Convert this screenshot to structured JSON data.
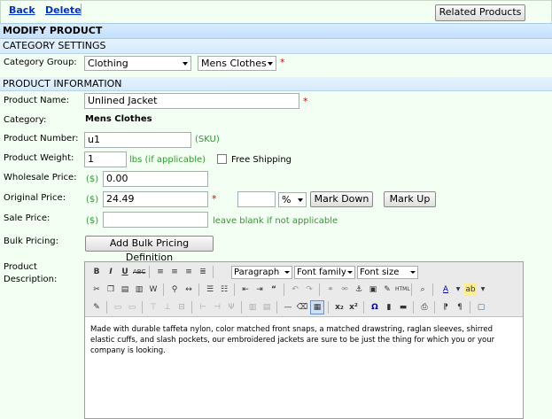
{
  "toolbar": {
    "back": "Back",
    "delete": "Delete",
    "related_products": "Related Products"
  },
  "header": {
    "title": "MODIFY PRODUCT"
  },
  "category_settings": {
    "title": "CATEGORY SETTINGS",
    "group_label": "Category Group:",
    "group_value": "Clothing",
    "sub_value": "Mens Clothes",
    "required": "*"
  },
  "product_info": {
    "title": "PRODUCT INFORMATION",
    "name_label": "Product Name:",
    "name_value": "Unlined Jacket",
    "category_label": "Category:",
    "category_value": "Mens Clothes",
    "number_label": "Product Number:",
    "number_value": "u1",
    "number_hint": "(SKU)",
    "weight_label": "Product Weight:",
    "weight_value": "1",
    "weight_hint": "lbs (if applicable)",
    "free_shipping": "Free Shipping",
    "wholesale_label": "Wholesale Price:",
    "currency": "($)",
    "wholesale_value": "0.00",
    "original_label": "Original Price:",
    "original_value": "24.49",
    "markdown_unit": "%",
    "mark_down": "Mark Down",
    "mark_up": "Mark Up",
    "sale_label": "Sale Price:",
    "sale_hint": "leave blank if not applicable",
    "bulk_label": "Bulk Pricing:",
    "bulk_button": "Add Bulk Pricing Definition",
    "description_label_1": "Product",
    "description_label_2": "Description:"
  },
  "editor": {
    "paragraph": "Paragraph",
    "font_family": "Font family",
    "font_size": "Font size",
    "content": "Made with durable taffeta nylon, color matched front snaps, a matched drawstring, raglan sleeves, shirred elastic cuffs, and slash pockets, our embroidered jackets are sure to be just the thing for which you or your company is looking."
  },
  "colors": {
    "section_bg": "#c3e0fb",
    "row_bg": "#f4fff4",
    "hint_green": "#2f9a2f",
    "required_red": "#e00000",
    "link_blue": "#0033cc"
  }
}
